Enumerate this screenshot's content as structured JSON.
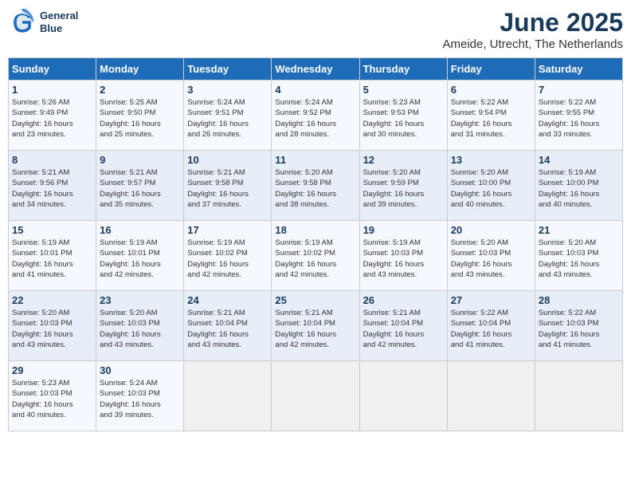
{
  "logo": {
    "line1": "General",
    "line2": "Blue"
  },
  "title": "June 2025",
  "subtitle": "Ameide, Utrecht, The Netherlands",
  "weekdays": [
    "Sunday",
    "Monday",
    "Tuesday",
    "Wednesday",
    "Thursday",
    "Friday",
    "Saturday"
  ],
  "weeks": [
    [
      {
        "day": "1",
        "sunrise": "5:26 AM",
        "sunset": "9:49 PM",
        "daylight": "16 hours and 23 minutes."
      },
      {
        "day": "2",
        "sunrise": "5:25 AM",
        "sunset": "9:50 PM",
        "daylight": "16 hours and 25 minutes."
      },
      {
        "day": "3",
        "sunrise": "5:24 AM",
        "sunset": "9:51 PM",
        "daylight": "16 hours and 26 minutes."
      },
      {
        "day": "4",
        "sunrise": "5:24 AM",
        "sunset": "9:52 PM",
        "daylight": "16 hours and 28 minutes."
      },
      {
        "day": "5",
        "sunrise": "5:23 AM",
        "sunset": "9:53 PM",
        "daylight": "16 hours and 30 minutes."
      },
      {
        "day": "6",
        "sunrise": "5:22 AM",
        "sunset": "9:54 PM",
        "daylight": "16 hours and 31 minutes."
      },
      {
        "day": "7",
        "sunrise": "5:22 AM",
        "sunset": "9:55 PM",
        "daylight": "16 hours and 33 minutes."
      }
    ],
    [
      {
        "day": "8",
        "sunrise": "5:21 AM",
        "sunset": "9:56 PM",
        "daylight": "16 hours and 34 minutes."
      },
      {
        "day": "9",
        "sunrise": "5:21 AM",
        "sunset": "9:57 PM",
        "daylight": "16 hours and 35 minutes."
      },
      {
        "day": "10",
        "sunrise": "5:21 AM",
        "sunset": "9:58 PM",
        "daylight": "16 hours and 37 minutes."
      },
      {
        "day": "11",
        "sunrise": "5:20 AM",
        "sunset": "9:58 PM",
        "daylight": "16 hours and 38 minutes."
      },
      {
        "day": "12",
        "sunrise": "5:20 AM",
        "sunset": "9:59 PM",
        "daylight": "16 hours and 39 minutes."
      },
      {
        "day": "13",
        "sunrise": "5:20 AM",
        "sunset": "10:00 PM",
        "daylight": "16 hours and 40 minutes."
      },
      {
        "day": "14",
        "sunrise": "5:19 AM",
        "sunset": "10:00 PM",
        "daylight": "16 hours and 40 minutes."
      }
    ],
    [
      {
        "day": "15",
        "sunrise": "5:19 AM",
        "sunset": "10:01 PM",
        "daylight": "16 hours and 41 minutes."
      },
      {
        "day": "16",
        "sunrise": "5:19 AM",
        "sunset": "10:01 PM",
        "daylight": "16 hours and 42 minutes."
      },
      {
        "day": "17",
        "sunrise": "5:19 AM",
        "sunset": "10:02 PM",
        "daylight": "16 hours and 42 minutes."
      },
      {
        "day": "18",
        "sunrise": "5:19 AM",
        "sunset": "10:02 PM",
        "daylight": "16 hours and 42 minutes."
      },
      {
        "day": "19",
        "sunrise": "5:19 AM",
        "sunset": "10:03 PM",
        "daylight": "16 hours and 43 minutes."
      },
      {
        "day": "20",
        "sunrise": "5:20 AM",
        "sunset": "10:03 PM",
        "daylight": "16 hours and 43 minutes."
      },
      {
        "day": "21",
        "sunrise": "5:20 AM",
        "sunset": "10:03 PM",
        "daylight": "16 hours and 43 minutes."
      }
    ],
    [
      {
        "day": "22",
        "sunrise": "5:20 AM",
        "sunset": "10:03 PM",
        "daylight": "16 hours and 43 minutes."
      },
      {
        "day": "23",
        "sunrise": "5:20 AM",
        "sunset": "10:03 PM",
        "daylight": "16 hours and 43 minutes."
      },
      {
        "day": "24",
        "sunrise": "5:21 AM",
        "sunset": "10:04 PM",
        "daylight": "16 hours and 43 minutes."
      },
      {
        "day": "25",
        "sunrise": "5:21 AM",
        "sunset": "10:04 PM",
        "daylight": "16 hours and 42 minutes."
      },
      {
        "day": "26",
        "sunrise": "5:21 AM",
        "sunset": "10:04 PM",
        "daylight": "16 hours and 42 minutes."
      },
      {
        "day": "27",
        "sunrise": "5:22 AM",
        "sunset": "10:04 PM",
        "daylight": "16 hours and 41 minutes."
      },
      {
        "day": "28",
        "sunrise": "5:22 AM",
        "sunset": "10:03 PM",
        "daylight": "16 hours and 41 minutes."
      }
    ],
    [
      {
        "day": "29",
        "sunrise": "5:23 AM",
        "sunset": "10:03 PM",
        "daylight": "16 hours and 40 minutes."
      },
      {
        "day": "30",
        "sunrise": "5:24 AM",
        "sunset": "10:03 PM",
        "daylight": "16 hours and 39 minutes."
      },
      null,
      null,
      null,
      null,
      null
    ]
  ]
}
